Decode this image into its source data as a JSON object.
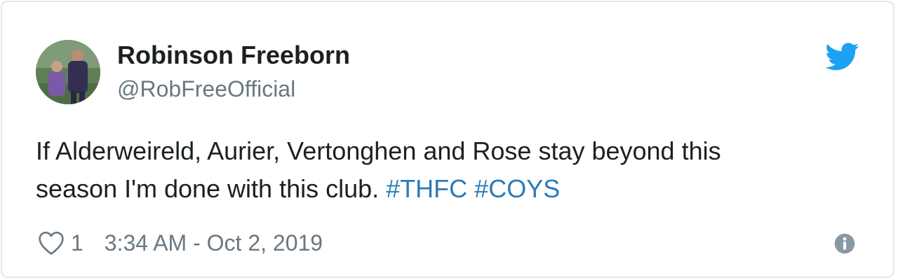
{
  "author": {
    "display_name": "Robinson Freeborn",
    "handle": "@RobFreeOfficial",
    "avatar": "avatar"
  },
  "brand_icon": "twitter-bird-icon",
  "tweet": {
    "text_line1": "If Alderweireld, Aurier, Vertonghen and Rose stay beyond this",
    "text_line2": "season I'm done with this club.",
    "hashtags": [
      "#THFC",
      "#COYS"
    ]
  },
  "footer": {
    "like_icon": "heart-icon",
    "like_count": "1",
    "timestamp": "3:34 AM - Oct 2, 2019",
    "info_icon": "info-icon"
  },
  "colors": {
    "twitter_blue": "#1da1f2",
    "hashtag": "#2b7bb9",
    "secondary_text": "#697882",
    "primary_text": "#1c2022",
    "border": "#e1e8ed"
  }
}
